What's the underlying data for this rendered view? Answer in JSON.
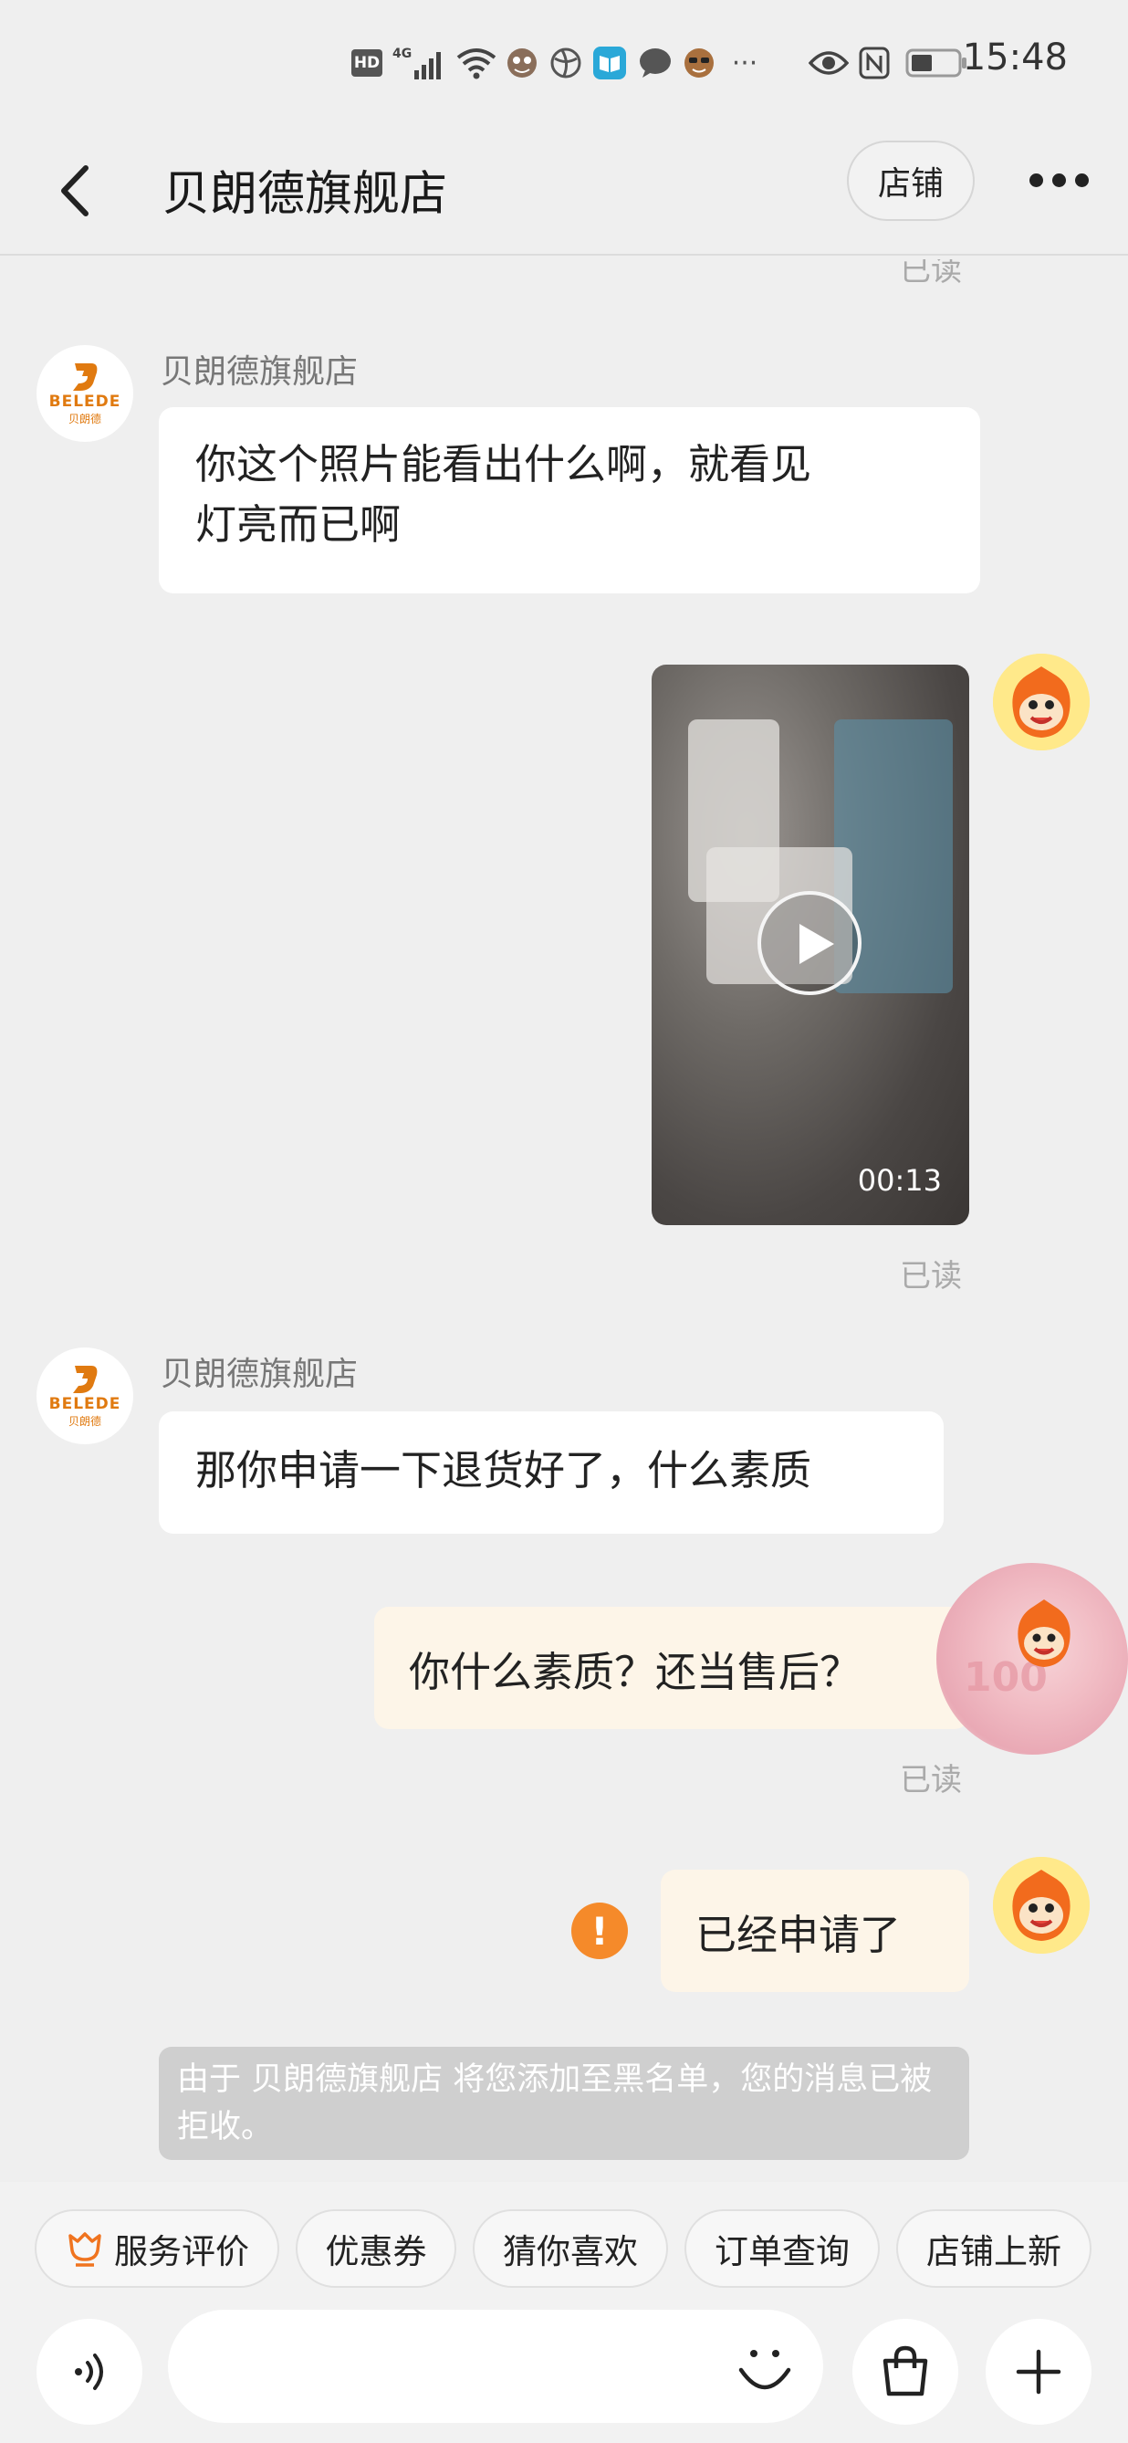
{
  "status_bar": {
    "time": "15:48",
    "network_badge": "HD",
    "network_type": "4G",
    "more_dots": "···",
    "icons": [
      "hd-icon",
      "signal-icon",
      "wifi-icon",
      "app-notification-icon",
      "browser-icon",
      "reader-icon",
      "message-icon",
      "app-notification-icon",
      "eye-icon",
      "nfc-icon",
      "battery-icon"
    ]
  },
  "header": {
    "title": "贝朗德旗舰店",
    "shop_button": "店铺"
  },
  "conversation": {
    "top_read_status": "已读",
    "messages": [
      {
        "side": "left",
        "sender": "贝朗德旗舰店",
        "lines": [
          "你这个照片能看出什么啊，就看见",
          "灯亮而已啊"
        ]
      },
      {
        "side": "right",
        "type": "video",
        "duration": "00:13",
        "status": "已读"
      },
      {
        "side": "left",
        "sender": "贝朗德旗舰店",
        "text": "那你申请一下退货好了，什么素质"
      },
      {
        "side": "right",
        "text": "你什么素质？还当售后？",
        "status": "已读"
      },
      {
        "side": "right",
        "text": "已经申请了",
        "failed": true,
        "failed_mark": "!"
      }
    ],
    "system_notice": "由于 贝朗德旗舰店 将您添加至黑名单，您的消息已被拒收。"
  },
  "shop_avatar": {
    "brand": "BELEDE",
    "brand_cn": "贝朗德"
  },
  "quick_actions": [
    "服务评价",
    "优惠券",
    "猜你喜欢",
    "订单查询",
    "店铺上新"
  ],
  "colors": {
    "accent": "#f58a2a",
    "brand": "#e07a10",
    "background": "#efefef",
    "right_bubble": "#fdf5e8"
  }
}
